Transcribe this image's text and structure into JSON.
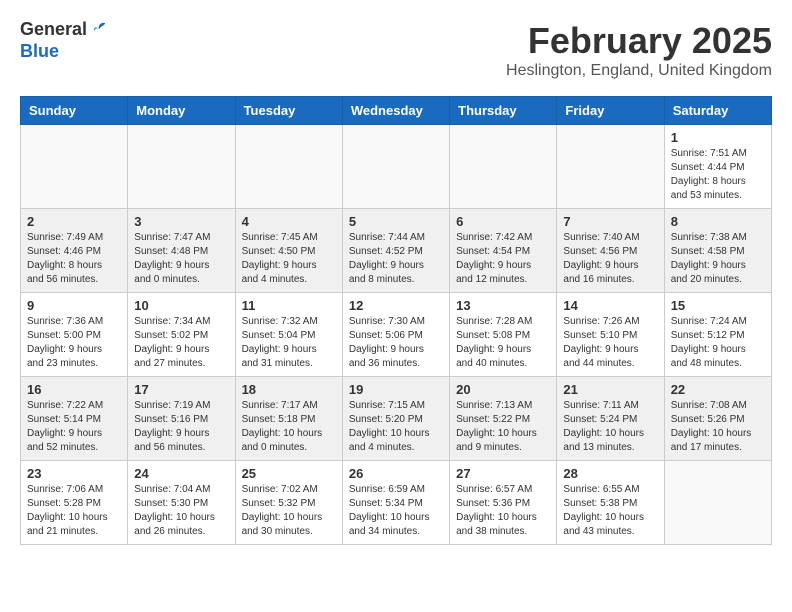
{
  "header": {
    "logo_general": "General",
    "logo_blue": "Blue",
    "month_title": "February 2025",
    "location": "Heslington, England, United Kingdom"
  },
  "calendar": {
    "days_of_week": [
      "Sunday",
      "Monday",
      "Tuesday",
      "Wednesday",
      "Thursday",
      "Friday",
      "Saturday"
    ],
    "weeks": [
      {
        "days": [
          {
            "num": "",
            "info": ""
          },
          {
            "num": "",
            "info": ""
          },
          {
            "num": "",
            "info": ""
          },
          {
            "num": "",
            "info": ""
          },
          {
            "num": "",
            "info": ""
          },
          {
            "num": "",
            "info": ""
          },
          {
            "num": "1",
            "info": "Sunrise: 7:51 AM\nSunset: 4:44 PM\nDaylight: 8 hours and 53 minutes."
          }
        ]
      },
      {
        "days": [
          {
            "num": "2",
            "info": "Sunrise: 7:49 AM\nSunset: 4:46 PM\nDaylight: 8 hours and 56 minutes."
          },
          {
            "num": "3",
            "info": "Sunrise: 7:47 AM\nSunset: 4:48 PM\nDaylight: 9 hours and 0 minutes."
          },
          {
            "num": "4",
            "info": "Sunrise: 7:45 AM\nSunset: 4:50 PM\nDaylight: 9 hours and 4 minutes."
          },
          {
            "num": "5",
            "info": "Sunrise: 7:44 AM\nSunset: 4:52 PM\nDaylight: 9 hours and 8 minutes."
          },
          {
            "num": "6",
            "info": "Sunrise: 7:42 AM\nSunset: 4:54 PM\nDaylight: 9 hours and 12 minutes."
          },
          {
            "num": "7",
            "info": "Sunrise: 7:40 AM\nSunset: 4:56 PM\nDaylight: 9 hours and 16 minutes."
          },
          {
            "num": "8",
            "info": "Sunrise: 7:38 AM\nSunset: 4:58 PM\nDaylight: 9 hours and 20 minutes."
          }
        ]
      },
      {
        "days": [
          {
            "num": "9",
            "info": "Sunrise: 7:36 AM\nSunset: 5:00 PM\nDaylight: 9 hours and 23 minutes."
          },
          {
            "num": "10",
            "info": "Sunrise: 7:34 AM\nSunset: 5:02 PM\nDaylight: 9 hours and 27 minutes."
          },
          {
            "num": "11",
            "info": "Sunrise: 7:32 AM\nSunset: 5:04 PM\nDaylight: 9 hours and 31 minutes."
          },
          {
            "num": "12",
            "info": "Sunrise: 7:30 AM\nSunset: 5:06 PM\nDaylight: 9 hours and 36 minutes."
          },
          {
            "num": "13",
            "info": "Sunrise: 7:28 AM\nSunset: 5:08 PM\nDaylight: 9 hours and 40 minutes."
          },
          {
            "num": "14",
            "info": "Sunrise: 7:26 AM\nSunset: 5:10 PM\nDaylight: 9 hours and 44 minutes."
          },
          {
            "num": "15",
            "info": "Sunrise: 7:24 AM\nSunset: 5:12 PM\nDaylight: 9 hours and 48 minutes."
          }
        ]
      },
      {
        "days": [
          {
            "num": "16",
            "info": "Sunrise: 7:22 AM\nSunset: 5:14 PM\nDaylight: 9 hours and 52 minutes."
          },
          {
            "num": "17",
            "info": "Sunrise: 7:19 AM\nSunset: 5:16 PM\nDaylight: 9 hours and 56 minutes."
          },
          {
            "num": "18",
            "info": "Sunrise: 7:17 AM\nSunset: 5:18 PM\nDaylight: 10 hours and 0 minutes."
          },
          {
            "num": "19",
            "info": "Sunrise: 7:15 AM\nSunset: 5:20 PM\nDaylight: 10 hours and 4 minutes."
          },
          {
            "num": "20",
            "info": "Sunrise: 7:13 AM\nSunset: 5:22 PM\nDaylight: 10 hours and 9 minutes."
          },
          {
            "num": "21",
            "info": "Sunrise: 7:11 AM\nSunset: 5:24 PM\nDaylight: 10 hours and 13 minutes."
          },
          {
            "num": "22",
            "info": "Sunrise: 7:08 AM\nSunset: 5:26 PM\nDaylight: 10 hours and 17 minutes."
          }
        ]
      },
      {
        "days": [
          {
            "num": "23",
            "info": "Sunrise: 7:06 AM\nSunset: 5:28 PM\nDaylight: 10 hours and 21 minutes."
          },
          {
            "num": "24",
            "info": "Sunrise: 7:04 AM\nSunset: 5:30 PM\nDaylight: 10 hours and 26 minutes."
          },
          {
            "num": "25",
            "info": "Sunrise: 7:02 AM\nSunset: 5:32 PM\nDaylight: 10 hours and 30 minutes."
          },
          {
            "num": "26",
            "info": "Sunrise: 6:59 AM\nSunset: 5:34 PM\nDaylight: 10 hours and 34 minutes."
          },
          {
            "num": "27",
            "info": "Sunrise: 6:57 AM\nSunset: 5:36 PM\nDaylight: 10 hours and 38 minutes."
          },
          {
            "num": "28",
            "info": "Sunrise: 6:55 AM\nSunset: 5:38 PM\nDaylight: 10 hours and 43 minutes."
          },
          {
            "num": "",
            "info": ""
          }
        ]
      }
    ]
  }
}
